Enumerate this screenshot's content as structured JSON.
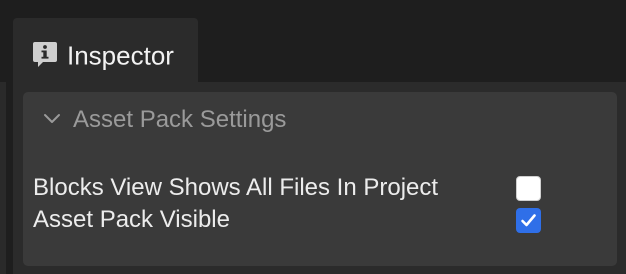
{
  "tab": {
    "label": "Inspector",
    "icon": "info-icon"
  },
  "section": {
    "title": "Asset Pack Settings",
    "expanded": true,
    "icon": "chevron-down-icon"
  },
  "properties": [
    {
      "label": "Blocks View Shows All Files In Project",
      "checked": false
    },
    {
      "label": "Asset Pack Visible",
      "checked": true
    }
  ],
  "colors": {
    "checkbox_checked": "#2f6fe8",
    "background": "#1e1e1e",
    "panel": "#2b2b2b",
    "section": "#3a3a3a"
  }
}
